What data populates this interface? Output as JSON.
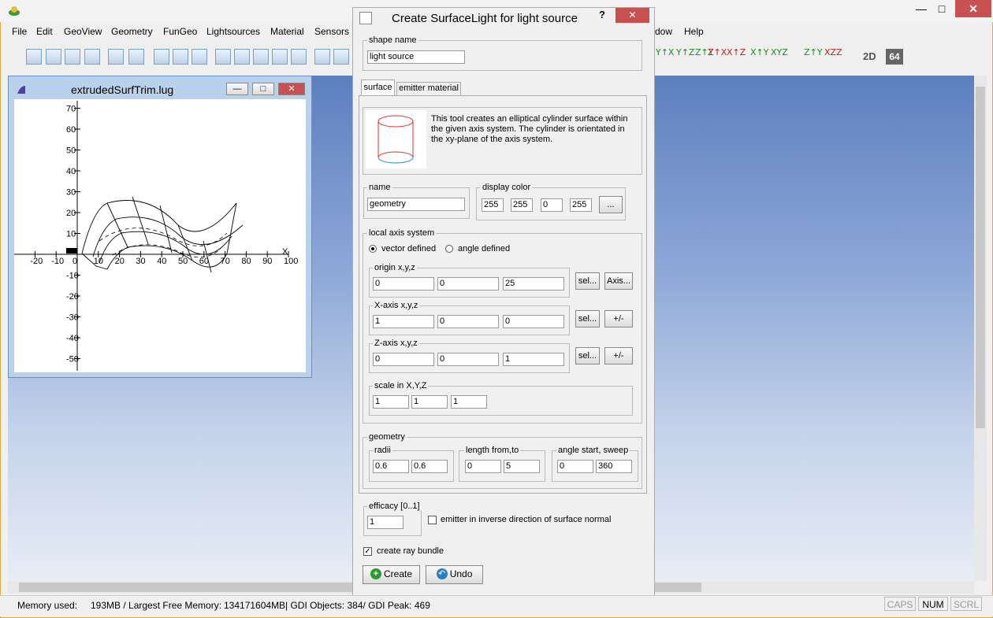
{
  "menu": [
    "File",
    "Edit",
    "GeoView",
    "Geometry",
    "FunGeo",
    "Lightsources",
    "Material",
    "Sensors",
    "dow",
    "Help"
  ],
  "window_controls": {
    "minimize": "—",
    "maximize": "□",
    "close": "✕"
  },
  "toolbar_labels": {
    "twod": "2D",
    "sixtyfour": "64"
  },
  "child": {
    "title": "extrudedSurfTrim.lug",
    "minimize": "—",
    "maximize": "□",
    "close": "✕"
  },
  "plot": {
    "x_ticks": [
      "-20",
      "-10",
      "0",
      "10",
      "20",
      "30",
      "40",
      "50",
      "60",
      "70",
      "80",
      "90",
      "100"
    ],
    "y_ticks": [
      "70",
      "60",
      "50",
      "40",
      "30",
      "20",
      "10",
      "-10",
      "-20",
      "-30",
      "-40",
      "-50"
    ],
    "x_axis_label": "X"
  },
  "dialog": {
    "title": "Create SurfaceLight for light source",
    "help": "?",
    "close": "✕",
    "shape_name_label": "shape name",
    "shape_name_value": "light source",
    "tabs": [
      "surface",
      "emitter material"
    ],
    "description": "This tool creates an elliptical cylinder surface within the given axis system. The cylinder is orientated in the xy-plane of the axis system.",
    "name_label": "name",
    "name_value": "geometry",
    "display_color_label": "display color",
    "display_color": [
      "255",
      "255",
      "0",
      "255"
    ],
    "color_button": "...",
    "local_axis_label": "local axis system",
    "radio_vector": "vector defined",
    "radio_angle": "angle defined",
    "origin_label": "origin x,y,z",
    "origin": [
      "0",
      "0",
      "25"
    ],
    "xaxis_label": "X-axis x,y,z",
    "xaxis": [
      "1",
      "0",
      "0"
    ],
    "zaxis_label": "Z-axis x,y,z",
    "zaxis": [
      "0",
      "0",
      "1"
    ],
    "sel_label": "sel...",
    "axis_button": "Axis...",
    "flip_button": "+/-",
    "scale_label": "scale in X,Y,Z",
    "scale": [
      "1",
      "1",
      "1"
    ],
    "geometry_label": "geometry",
    "radii_label": "radii",
    "radii": [
      "0.6",
      "0.6"
    ],
    "length_label": "length from,to",
    "length": [
      "0",
      "5"
    ],
    "angle_label": "angle start, sweep",
    "angle": [
      "0",
      "360"
    ],
    "efficacy_label": "efficacy [0..1]",
    "efficacy_value": "1",
    "inverse_label": "emitter in inverse direction of surface normal",
    "ray_bundle_label": "create ray bundle",
    "create_button": "Create",
    "undo_button": "Undo"
  },
  "status": {
    "memory_label": "Memory used:",
    "memory_value": "193MB / Largest Free Memory:",
    "free_value": "134171604MB",
    "gdi": "|  GDI Objects: 384/ GDI Peak: 469",
    "caps": "CAPS",
    "num": "NUM",
    "scrl": "SCRL"
  },
  "colors": {
    "accent": "#e9a43b",
    "close": "#c75050",
    "workspace_top": "#5d7fbf"
  }
}
